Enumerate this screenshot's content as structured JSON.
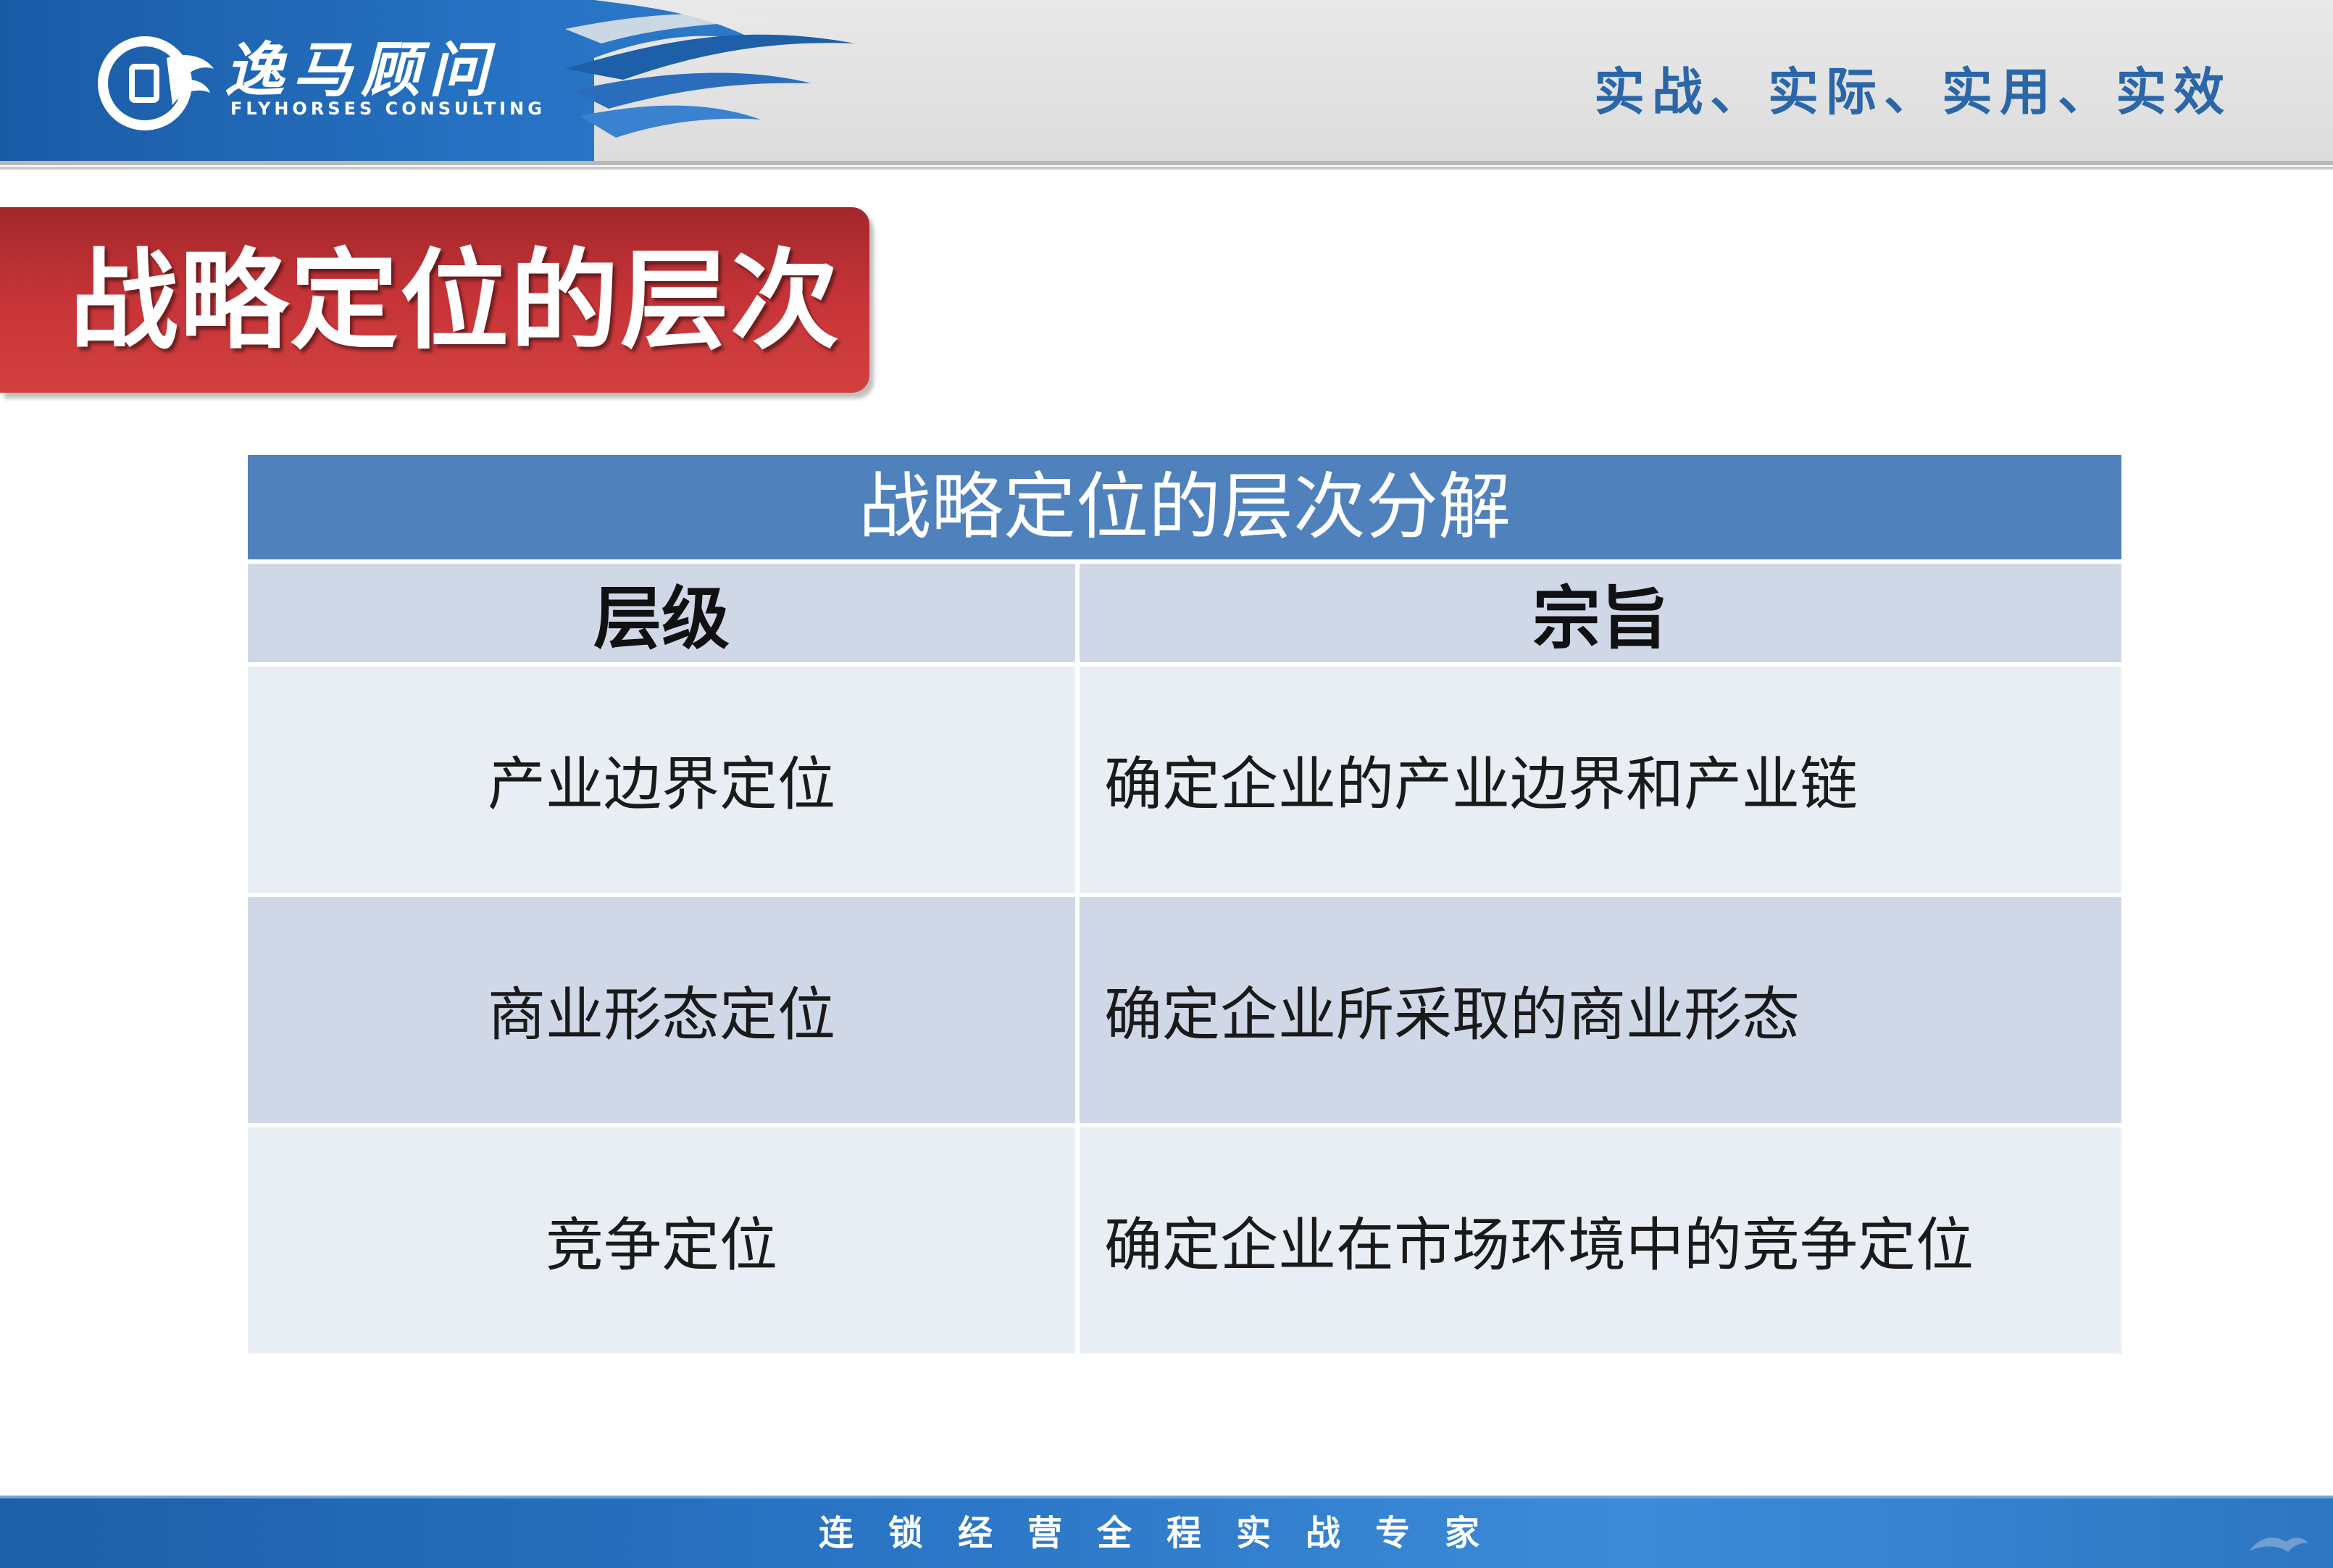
{
  "header": {
    "brand_name": "逸马顾问",
    "brand_sub": "FLYHORSES CONSULTING",
    "slogan": "实战、实际、实用、实效"
  },
  "title": "战略定位的层次",
  "table": {
    "caption": "战略定位的层次分解",
    "columns": [
      "层级",
      "宗旨"
    ],
    "rows": [
      [
        "产业边界定位",
        "确定企业的产业边界和产业链"
      ],
      [
        "商业形态定位",
        "确定企业所采取的商业形态"
      ],
      [
        "竞争定位",
        "确定企业在市场环境中的竞争定位"
      ]
    ]
  },
  "footer": {
    "text": "连锁经营全程实战专家"
  },
  "colors": {
    "header_blue": "#1f63b0",
    "title_red": "#c73438",
    "table_header": "#4f81bd",
    "row_light": "#e9edf4",
    "row_dark": "#d0d8e8",
    "slogan_blue": "#2a66a8"
  },
  "icons": [
    "horse-logo-icon",
    "wave-swoosh-icon",
    "corner-logo-icon"
  ]
}
